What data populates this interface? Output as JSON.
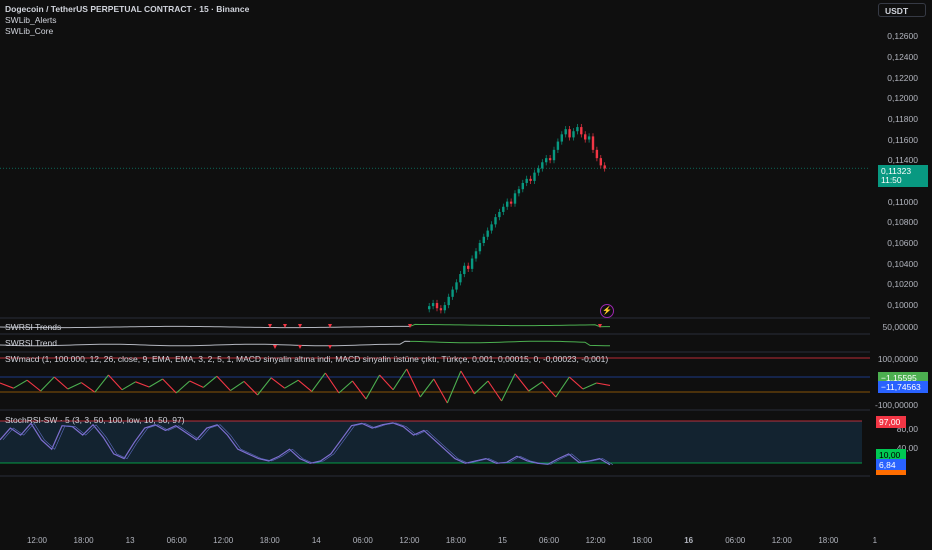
{
  "header": {
    "title": "Dogecoin / TetherUS PERPETUAL CONTRACT · 15 · Binance",
    "indicators": [
      "SWLib_Alerts",
      "SWLib_Core"
    ],
    "currency_button": "USDT"
  },
  "price_axis": {
    "labels": [
      "0,12600",
      "0,12400",
      "0,12200",
      "0,12000",
      "0,11800",
      "0,11600",
      "0,11400",
      "0,11000",
      "0,10800",
      "0,10600",
      "0,10400",
      "0,10200",
      "0,10000"
    ],
    "current_price": "0,11323",
    "countdown": "11:50"
  },
  "panes": {
    "swrsi1": {
      "label": "SWRSI Trends",
      "axis": "50,00000"
    },
    "swrsi2": {
      "label": "SWRSI Trend"
    },
    "macd": {
      "label": "SWmacd (1, 100.000, 12, 26, close, 9, EMA, EMA, 3, 2, 5, 1, MACD sinyalin altına indi, MACD sinyalin üstüne çıktı, Türkçe, 0,001, 0,00015, 0, -0,00023, -0,001)",
      "axis_top": "100,00000",
      "axis_bottom": "-100,00000",
      "value1": "−1,15595",
      "value2": "−11,74563",
      "value1_color": "#4caf50",
      "value2_color": "#2962ff"
    },
    "stoch": {
      "label": "StochRSI-SW · 5 (3, 3, 50, 100, low, 10, 50, 97)",
      "axis": [
        "80,00",
        "40,00"
      ],
      "upper": "97,00",
      "lower": "10,00",
      "value": "6,84",
      "upper_color": "#f23645",
      "lower_color": "#00c853",
      "value_color": "#2962ff",
      "extra_color": "#ff6d00"
    }
  },
  "time_axis": {
    "labels": [
      "12:00",
      "18:00",
      "13",
      "06:00",
      "12:00",
      "18:00",
      "14",
      "06:00",
      "12:00",
      "18:00",
      "15",
      "06:00",
      "12:00",
      "18:00",
      "16",
      "06:00",
      "12:00",
      "18:00",
      "1"
    ]
  },
  "colors": {
    "up": "#089981",
    "down": "#f23645",
    "bg": "#0f0f0f",
    "price_tag": "#089981"
  },
  "chart_data": {
    "type": "candlestick",
    "symbol": "DOGEUSDT.P",
    "interval": "15",
    "closes": [
      0.0999,
      0.1002,
      0.0997,
      0.0995,
      0.1,
      0.1008,
      0.1015,
      0.1022,
      0.103,
      0.1038,
      0.1035,
      0.1045,
      0.1052,
      0.106,
      0.1066,
      0.1072,
      0.1078,
      0.1085,
      0.109,
      0.1095,
      0.11,
      0.1098,
      0.1108,
      0.1112,
      0.1118,
      0.1122,
      0.112,
      0.1128,
      0.1132,
      0.1138,
      0.1142,
      0.114,
      0.115,
      0.1158,
      0.1165,
      0.117,
      0.1162,
      0.1168,
      0.1172,
      0.1165,
      0.116,
      0.1163,
      0.115,
      0.1142,
      0.1135,
      0.1132
    ],
    "ylim": [
      0.0995,
      0.127
    ],
    "macd": [
      5,
      -8,
      12,
      -15,
      20,
      -10,
      6,
      -18,
      25,
      -12,
      8,
      -5,
      15,
      -20,
      10,
      -6,
      22,
      -14,
      9,
      -25,
      18,
      -8,
      12,
      -16,
      30,
      -20,
      10,
      -35,
      25,
      -12,
      40,
      -30,
      15,
      -45,
      35,
      -22,
      10,
      -40,
      28,
      -15,
      8,
      -30,
      20,
      -10,
      5,
      -1
    ],
    "stoch": [
      60,
      85,
      70,
      95,
      60,
      40,
      90,
      88,
      70,
      92,
      65,
      30,
      20,
      55,
      85,
      92,
      80,
      90,
      75,
      60,
      85,
      92,
      70,
      40,
      30,
      20,
      15,
      25,
      40,
      20,
      10,
      15,
      30,
      60,
      90,
      95,
      85,
      92,
      96,
      88,
      70,
      80,
      60,
      40,
      20,
      10,
      15,
      20,
      10,
      12,
      25,
      15,
      10,
      8,
      20,
      30,
      12,
      15,
      20,
      7
    ]
  }
}
